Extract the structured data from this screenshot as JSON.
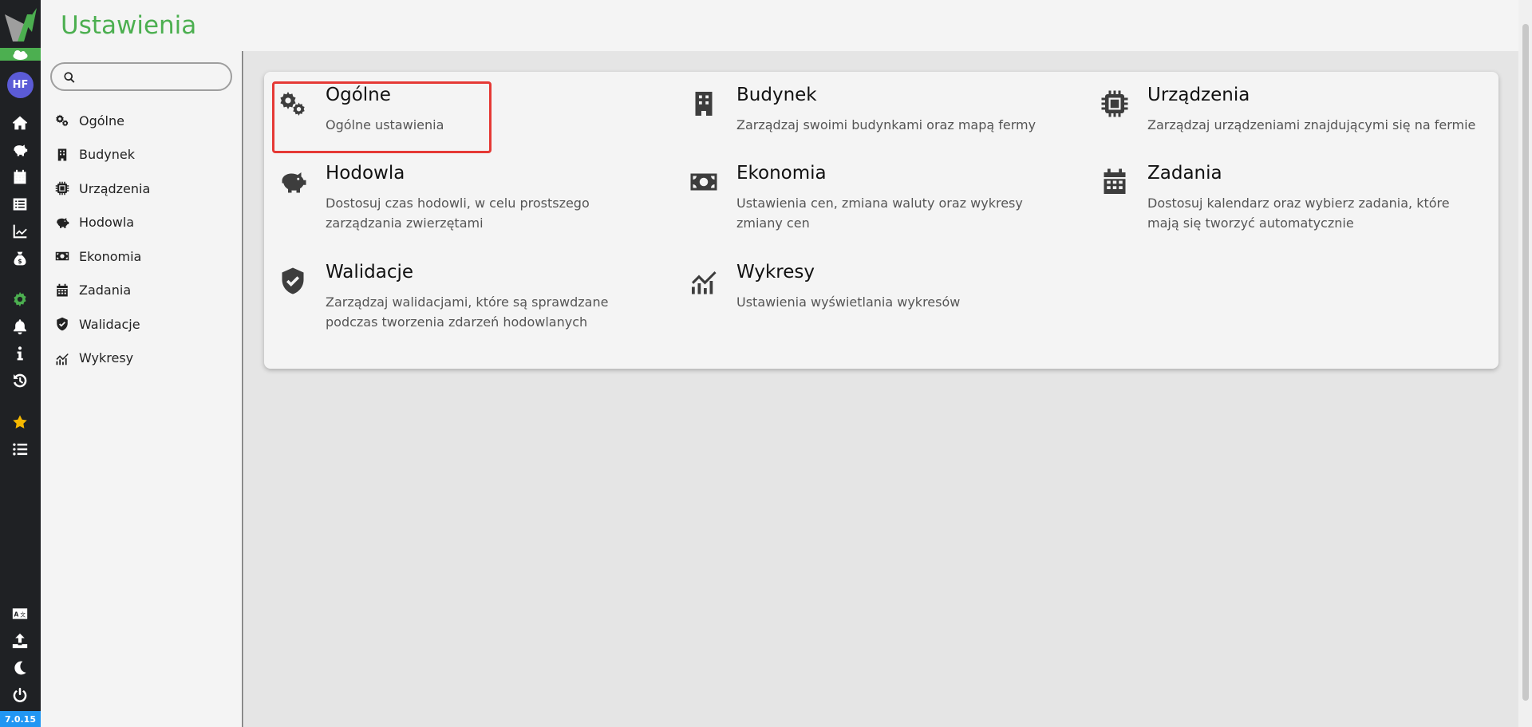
{
  "app": {
    "page_title": "Ustawienia",
    "avatar_initials": "HF",
    "version": "7.0.15",
    "accent_color": "#4caf50"
  },
  "rail": {
    "top_icons": [
      "home-icon",
      "piggy-bank-icon",
      "calendar-icon",
      "list-icon",
      "chart-line-icon",
      "money-bag-icon"
    ],
    "mid_icons": [
      "gear-icon",
      "bell-icon",
      "info-icon",
      "history-icon"
    ],
    "fav_icons": [
      "star-icon",
      "list-ul-icon"
    ],
    "bottom_icons": [
      "language-icon",
      "upload-icon",
      "moon-icon",
      "power-icon"
    ]
  },
  "search": {
    "placeholder": "",
    "value": ""
  },
  "sidebar": {
    "items": [
      {
        "label": "Ogólne",
        "icon": "gears-icon"
      },
      {
        "label": "Budynek",
        "icon": "building-icon"
      },
      {
        "label": "Urządzenia",
        "icon": "chip-icon"
      },
      {
        "label": "Hodowla",
        "icon": "piggy-bank-icon"
      },
      {
        "label": "Ekonomia",
        "icon": "money-bill-icon"
      },
      {
        "label": "Zadania",
        "icon": "calendar-icon"
      },
      {
        "label": "Walidacje",
        "icon": "shield-check-icon"
      },
      {
        "label": "Wykresy",
        "icon": "chart-bars-icon"
      }
    ]
  },
  "tiles": [
    {
      "title": "Ogólne",
      "description": "Ogólne ustawienia",
      "icon": "gears-icon",
      "highlighted": true
    },
    {
      "title": "Budynek",
      "description": "Zarządzaj swoimi budynkami oraz mapą fermy",
      "icon": "building-icon"
    },
    {
      "title": "Urządzenia",
      "description": "Zarządzaj urządzeniami znajdującymi się na fermie",
      "icon": "chip-icon"
    },
    {
      "title": "Hodowla",
      "description": "Dostosuj czas hodowli, w celu prostszego zarządzania zwierzętami",
      "icon": "piggy-bank-icon"
    },
    {
      "title": "Ekonomia",
      "description": "Ustawienia cen, zmiana waluty oraz wykresy zmiany cen",
      "icon": "money-bill-icon"
    },
    {
      "title": "Zadania",
      "description": "Dostosuj kalendarz oraz wybierz zadania, które mają się tworzyć automatycznie",
      "icon": "calendar-icon"
    },
    {
      "title": "Walidacje",
      "description": "Zarządzaj walidacjami, które są sprawdzane podczas tworzenia zdarzeń hodowlanych",
      "icon": "shield-check-icon"
    },
    {
      "title": "Wykresy",
      "description": "Ustawienia wyświetlania wykresów",
      "icon": "chart-bars-icon"
    }
  ]
}
